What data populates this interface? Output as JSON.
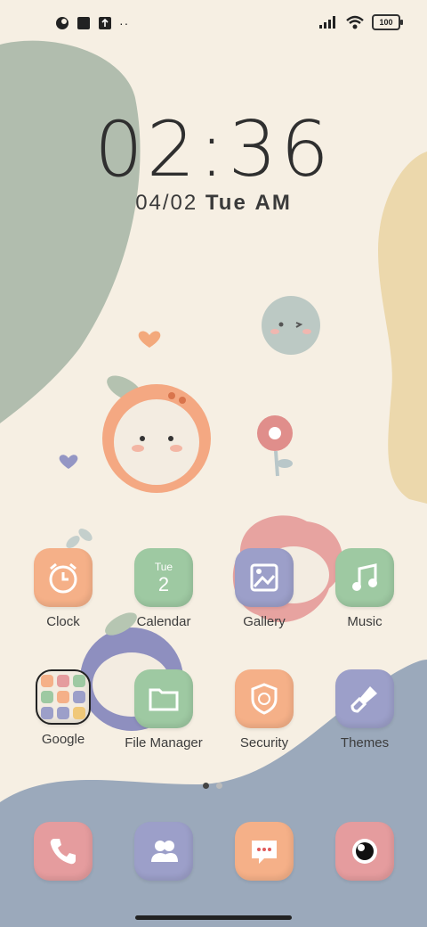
{
  "status_bar": {
    "battery": "100",
    "icons_left": [
      "app-icon",
      "square-icon",
      "upload-icon",
      "more-icon"
    ],
    "icons_right": [
      "signal-icon",
      "wifi-icon",
      "battery-icon"
    ]
  },
  "lock": {
    "time": "02:36",
    "date": "04/02",
    "weekday": "Tue",
    "ampm": "AM"
  },
  "apps_row1": [
    {
      "label": "Clock"
    },
    {
      "label": "Calendar",
      "day": "Tue",
      "date": "2"
    },
    {
      "label": "Gallery"
    },
    {
      "label": "Music"
    }
  ],
  "apps_row2": [
    {
      "label": "Google"
    },
    {
      "label": "File Manager"
    },
    {
      "label": "Security"
    },
    {
      "label": "Themes"
    }
  ],
  "dock": [
    "phone-icon",
    "contacts-icon",
    "messages-icon",
    "camera-icon"
  ],
  "colors": {
    "orange": "#f5b088",
    "green": "#9ec9a2",
    "purple": "#9c9fc9",
    "pink": "#e59c9e",
    "bg": "#f6efe3",
    "dock_bg": "#9ba9bb"
  }
}
